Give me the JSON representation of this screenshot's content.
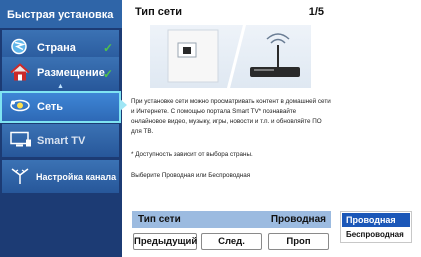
{
  "sidebar": {
    "title": "Быстрая установка",
    "items": [
      {
        "label": "Страна",
        "icon": "flag-icon",
        "checked": true
      },
      {
        "label": "Размещение",
        "icon": "home-icon",
        "checked": true
      },
      {
        "label": "Сеть",
        "icon": "network-icon",
        "checked": false,
        "active": true
      },
      {
        "label": "Smart TV",
        "icon": "tv-icon",
        "checked": false
      },
      {
        "label": "Настройка канала",
        "icon": "antenna-icon",
        "checked": false
      }
    ],
    "check_mark": "✓",
    "sub_arrow": "▲"
  },
  "panel": {
    "title": "Тип сети",
    "step": "1/5",
    "description": "При установке сети можно просматривать контент в домашней сети и Интернете. С помощью портала Smart TV* познавайте онлайновое видео, музыку, игры, новости и т.п. и обновляйте ПО для ТВ.",
    "note": "*  Доступность зависит от выбора страны.",
    "prompt": "Выберите Проводная или Беспроводная",
    "network_type_label": "Тип сети",
    "network_type_value": "Проводная",
    "buttons": {
      "prev": "Предыдущий",
      "next": "След.",
      "skip": "Проп"
    }
  },
  "dropdown": {
    "options": [
      "Проводная",
      "Беспроводная"
    ],
    "selected": "Проводная"
  },
  "colors": {
    "sidebar_bg": "#1c3b74",
    "item_bg": "#2f65a8",
    "active_border": "#7fe4f2",
    "check": "#4fc24a",
    "row_bg": "#9cbbe0",
    "dropdown_selected": "#1b57b8"
  }
}
